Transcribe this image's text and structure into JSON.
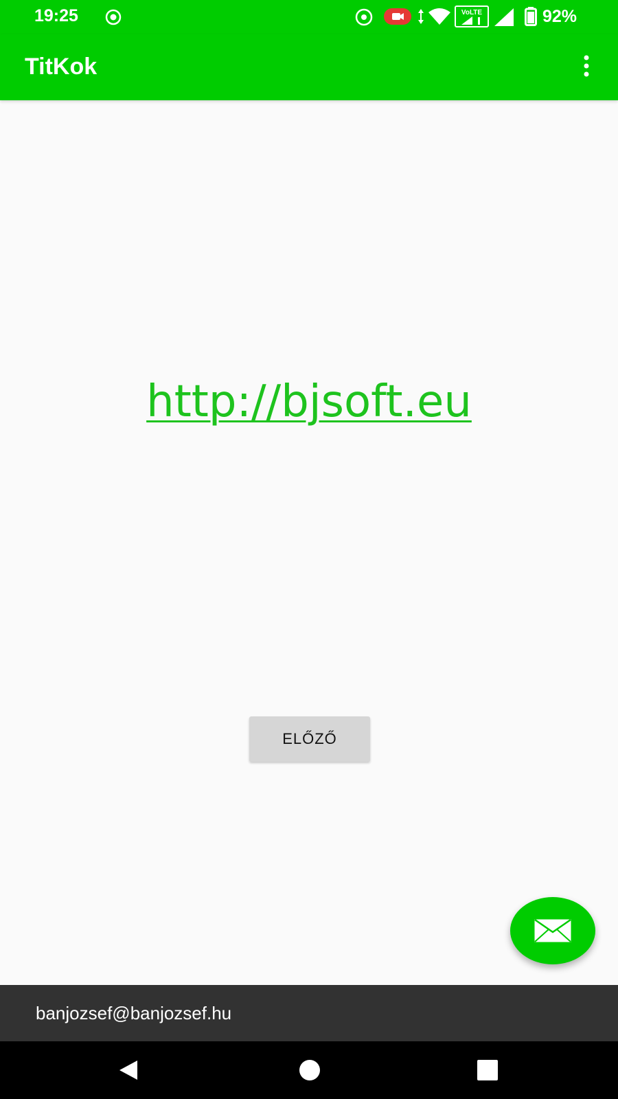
{
  "status_bar": {
    "time": "19:25",
    "battery_percent": "92%",
    "volte_label": "VoLTE"
  },
  "app_bar": {
    "title": "TitKok"
  },
  "main": {
    "link_text": "http://bjsoft.eu",
    "prev_button_label": "ELŐZŐ"
  },
  "fab": {
    "icon": "mail-icon"
  },
  "footer": {
    "email": "banjozsef@banjozsef.hu"
  },
  "colors": {
    "brand_green": "#00cc00",
    "link_green": "#1ec31e",
    "footer_bg": "#323232",
    "button_bg": "#d6d6d6"
  },
  "nav_bar": {
    "icons": [
      "back-icon",
      "home-icon",
      "recents-icon"
    ]
  }
}
